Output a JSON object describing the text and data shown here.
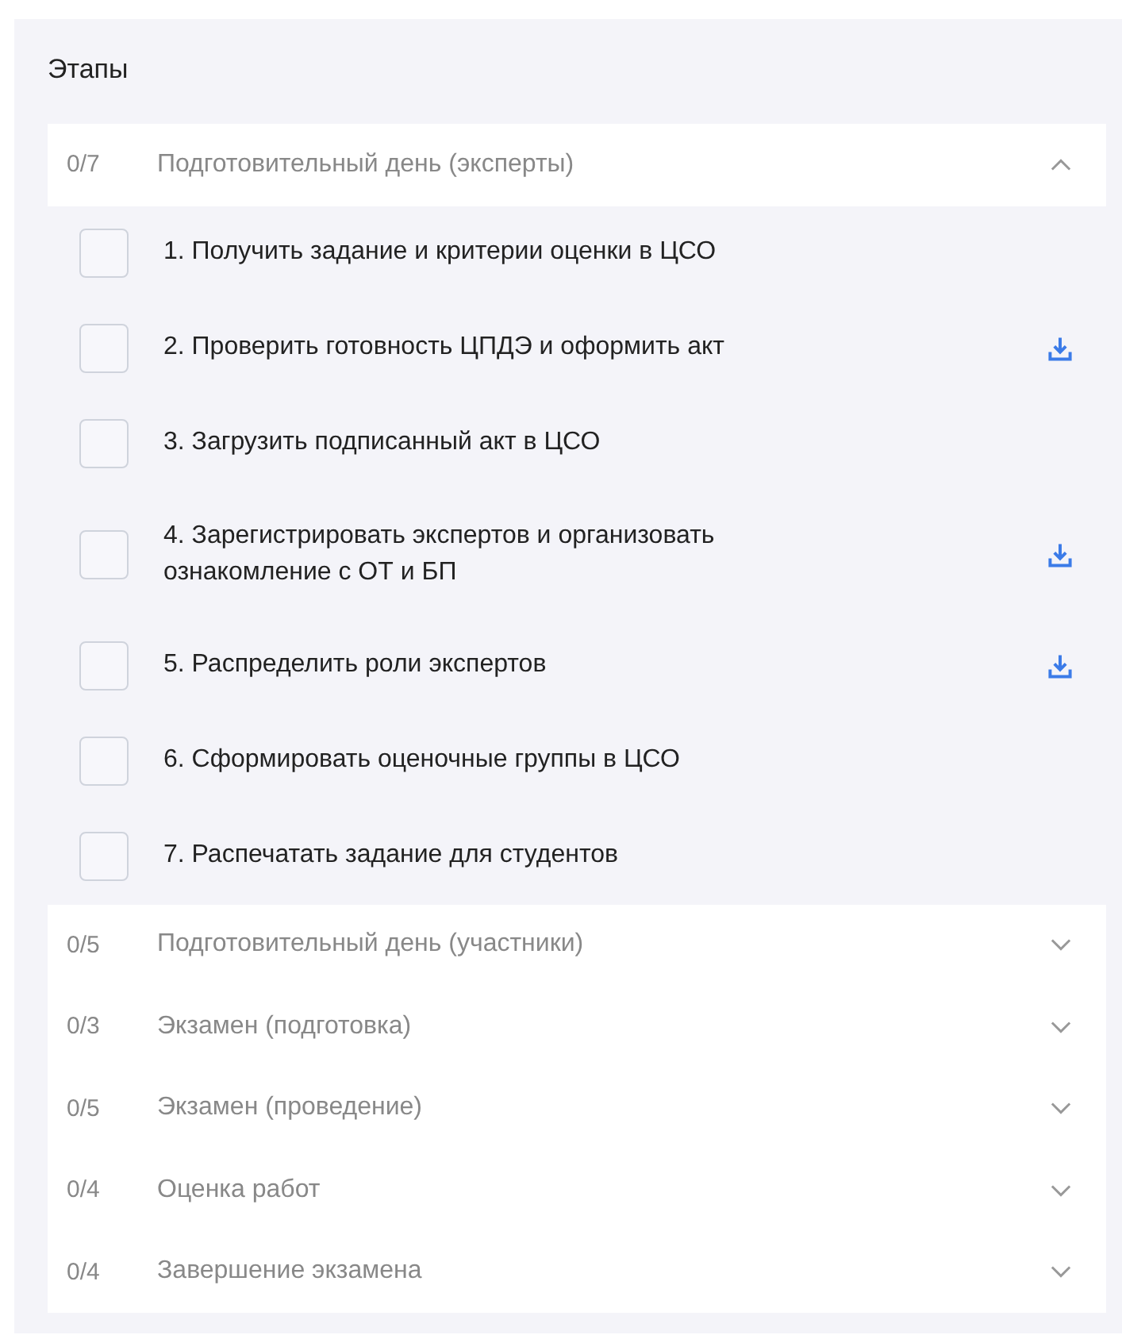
{
  "title": "Этапы",
  "stages": [
    {
      "count": "0/7",
      "title": "Подготовительный день (эксперты)",
      "expanded": true,
      "tasks": [
        {
          "label": "1. Получить задание и критерии оценки в ЦСО",
          "checked": false,
          "download": false
        },
        {
          "label": "2. Проверить готовность ЦПДЭ и оформить акт",
          "checked": false,
          "download": true
        },
        {
          "label": "3. Загрузить подписанный акт в ЦСО",
          "checked": false,
          "download": false
        },
        {
          "label": "4. Зарегистрировать экспертов и организовать ознакомление с ОТ и БП",
          "checked": false,
          "download": true
        },
        {
          "label": "5. Распределить роли экспертов",
          "checked": false,
          "download": true
        },
        {
          "label": "6. Сформировать оценочные группы в ЦСО",
          "checked": false,
          "download": false
        },
        {
          "label": "7. Распечатать задание для студентов",
          "checked": false,
          "download": false
        }
      ]
    },
    {
      "count": "0/5",
      "title": "Подготовительный день (участники)",
      "expanded": false
    },
    {
      "count": "0/3",
      "title": "Экзамен (подготовка)",
      "expanded": false
    },
    {
      "count": "0/5",
      "title": "Экзамен (проведение)",
      "expanded": false
    },
    {
      "count": "0/4",
      "title": "Оценка работ",
      "expanded": false
    },
    {
      "count": "0/4",
      "title": "Завершение экзамена",
      "expanded": false
    }
  ]
}
